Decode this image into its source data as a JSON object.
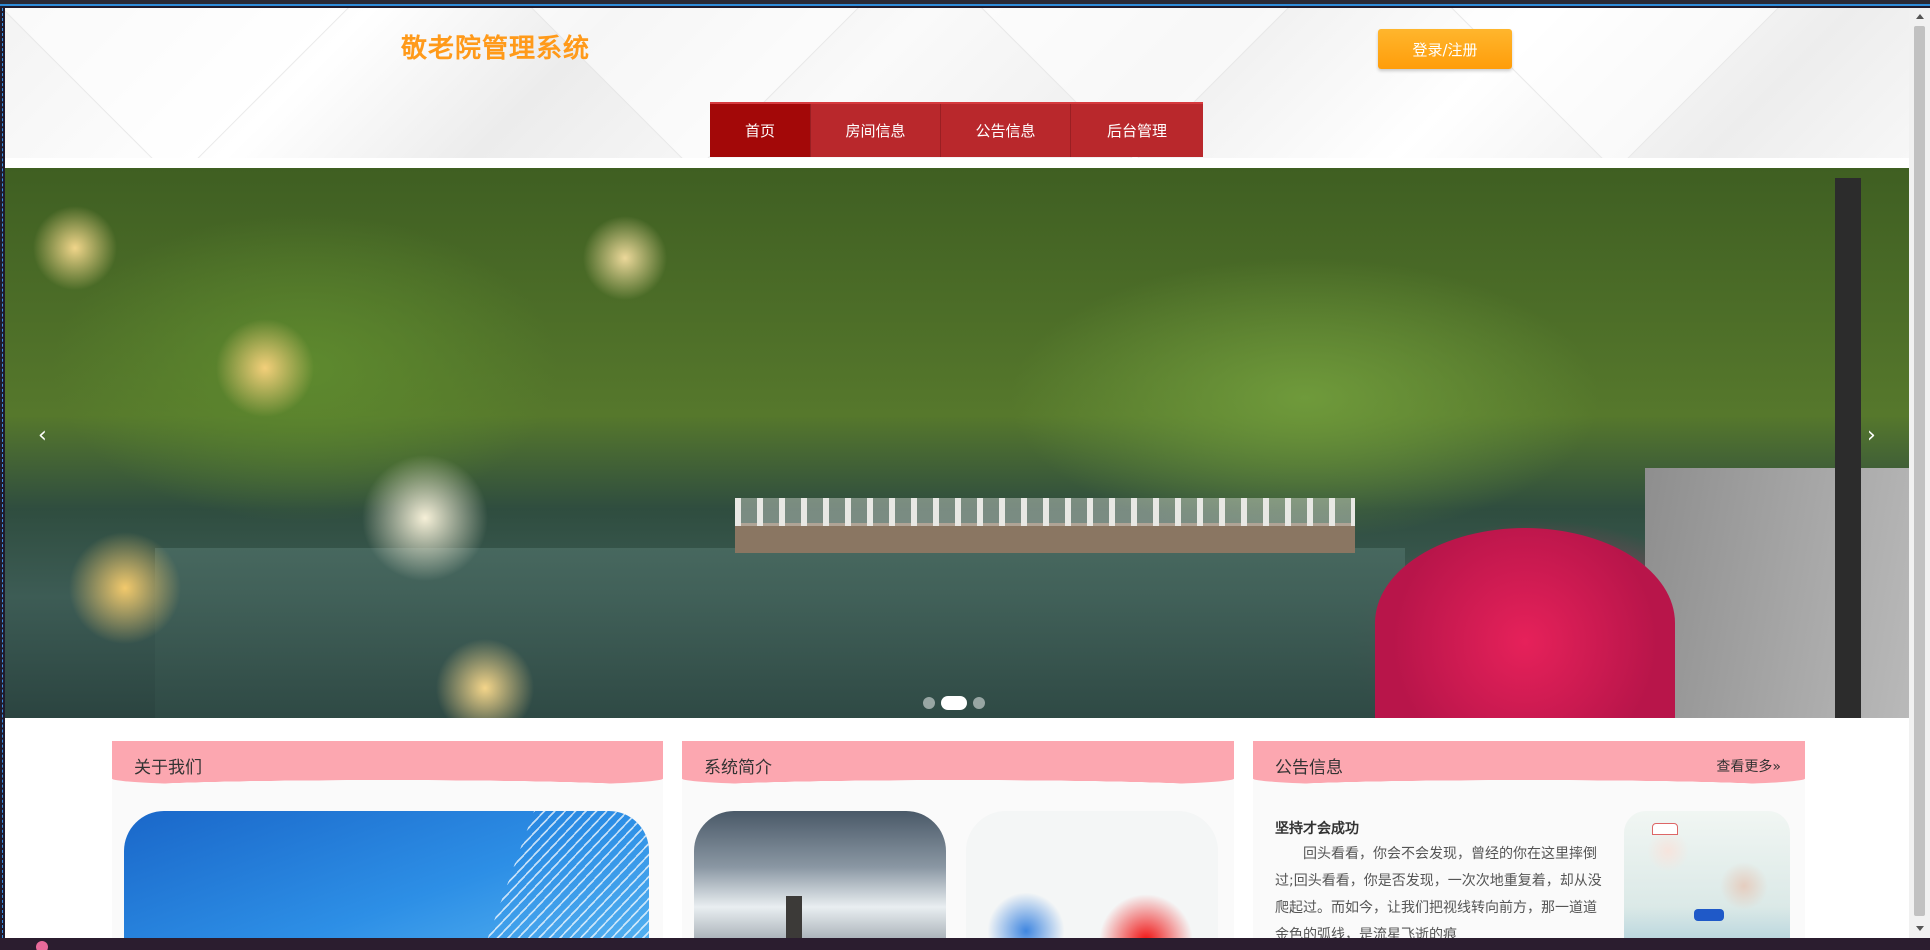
{
  "header": {
    "site_title": "敬老院管理系统",
    "login_label": "登录/注册"
  },
  "nav": {
    "items": [
      "首页",
      "房间信息",
      "公告信息",
      "后台管理"
    ],
    "active_index": 0
  },
  "hero": {
    "prev_arrow": "‹",
    "next_arrow": "›",
    "slide_count": 3,
    "active_slide": 2
  },
  "cards": {
    "about": {
      "title": "关于我们"
    },
    "intro": {
      "title": "系统简介"
    },
    "notice": {
      "title": "公告信息",
      "more_label": "查看更多",
      "more_icon": "»",
      "headline": "坚持才会成功",
      "body": "回头看看，你会不会发现，曾经的你在这里摔倒过;回头看看，你是否发现，一次次地重复着，却从没爬起过。而如今，让我们把视线转向前方，那一道道金色的弧线，是流星飞逝的痕"
    }
  },
  "colors": {
    "title_orange": "#ff9a1a",
    "login_orange": "#ffa91c",
    "nav_red": "#b9282c",
    "nav_active": "#a30808",
    "card_header_pink": "#fca7b0"
  }
}
